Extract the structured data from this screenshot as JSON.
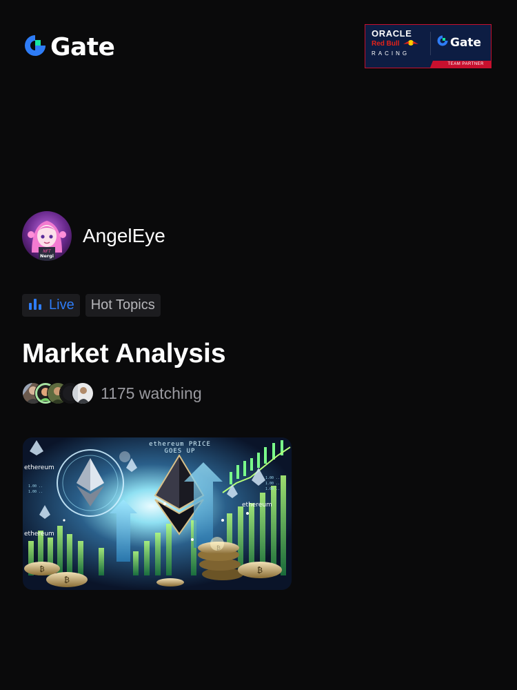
{
  "header": {
    "logo_text": "Gate",
    "partner": {
      "oracle": "ORACLE",
      "redbull": "Red Bull",
      "racing": "RACING",
      "gate_text": "Gate",
      "strip_label": "TEAM PARTNER"
    }
  },
  "author": {
    "name": "AngelEye",
    "avatar_caption": "NFT Nergi"
  },
  "tags": {
    "live_label": "Live",
    "hot_topics_label": "Hot Topics"
  },
  "post": {
    "title": "Market Analysis",
    "watching_text": "1175 watching",
    "watcher_count_shown": 5
  },
  "thumbnail": {
    "headline": "ethereum PRICE GOES UP",
    "brand_words": [
      "ethereum",
      "ethereum",
      "ethereum"
    ]
  },
  "colors": {
    "background": "#0a0a0b",
    "brand_blue": "#2e7cf6",
    "brand_green": "#17e5a0",
    "partner_navy": "#0d1d43",
    "partner_red": "#c8102e",
    "muted_text": "#9a9aa0"
  },
  "icons": {
    "live": "bar-chart-icon",
    "logo": "gate-logo-icon"
  }
}
